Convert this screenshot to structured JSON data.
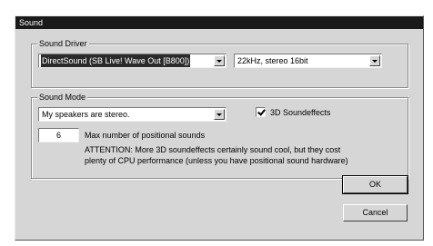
{
  "window": {
    "title": "Sound"
  },
  "sound_driver": {
    "legend": "Sound Driver",
    "device_value": "DirectSound (SB Live! Wave Out [B800])",
    "format_value": "22kHz, stereo 16bit"
  },
  "sound_mode": {
    "legend": "Sound Mode",
    "speaker_value": "My speakers are stereo.",
    "soundfx_label": "3D Soundeffects",
    "soundfx_checked": true,
    "positional_count": "6",
    "positional_label": "Max number of positional sounds",
    "attention_line1": "ATTENTION: More 3D soundeffects certainly sound cool, but they cost",
    "attention_line2": "plenty of CPU performance (unless you have positional sound hardware)"
  },
  "buttons": {
    "ok_label": "OK",
    "cancel_label": "Cancel"
  }
}
